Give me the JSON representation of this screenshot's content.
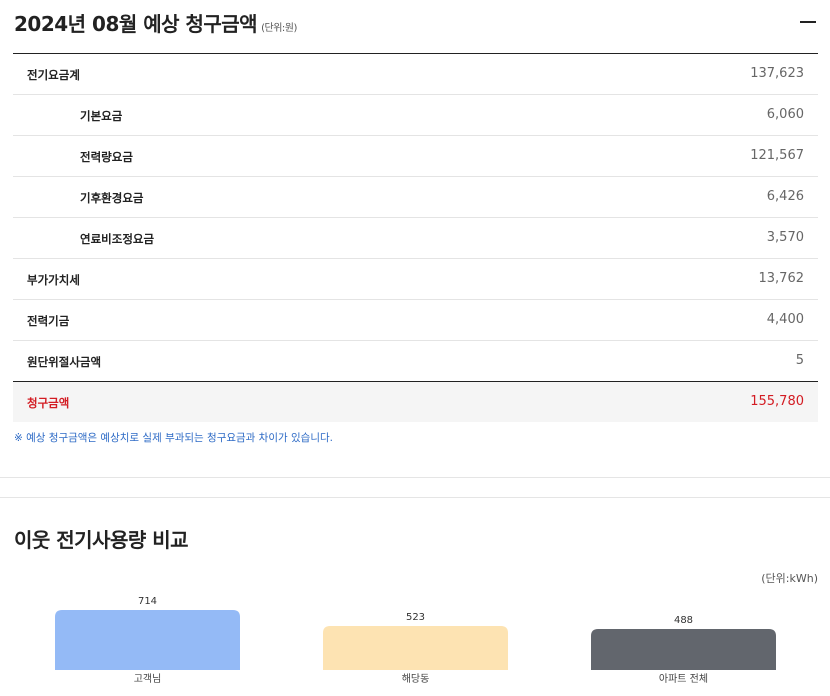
{
  "bill": {
    "title": "2024년 08월 예상 청구금액",
    "unit": "(단위:원)",
    "rows": [
      {
        "label": "전기요금계",
        "value": "137,623"
      },
      {
        "label": "기본요금",
        "value": "6,060"
      },
      {
        "label": "전력량요금",
        "value": "121,567"
      },
      {
        "label": "기후환경요금",
        "value": "6,426"
      },
      {
        "label": "연료비조정요금",
        "value": "3,570"
      },
      {
        "label": "부가가치세",
        "value": "13,762"
      },
      {
        "label": "전력기금",
        "value": "4,400"
      },
      {
        "label": "원단위절사금액",
        "value": "5"
      }
    ],
    "total": {
      "label": "청구금액",
      "value": "155,780"
    },
    "note": "※ 예상 청구금액은 예상치로 실제 부과되는 청구요금과 차이가 있습니다.",
    "collapse_icon": "minus-icon"
  },
  "comparison": {
    "title": "이웃 전기사용량 비교",
    "unit": "(단위:kWh)"
  },
  "chart_data": {
    "type": "bar",
    "categories": [
      "고객님",
      "해당동",
      "아파트 전체"
    ],
    "values": [
      714,
      523,
      488
    ],
    "value_labels": [
      "714",
      "523",
      "488"
    ],
    "colors": [
      "#94baf6",
      "#fde3b2",
      "#62666d"
    ],
    "ylim": [
      0,
      714
    ],
    "grid": false,
    "legend": "none"
  }
}
